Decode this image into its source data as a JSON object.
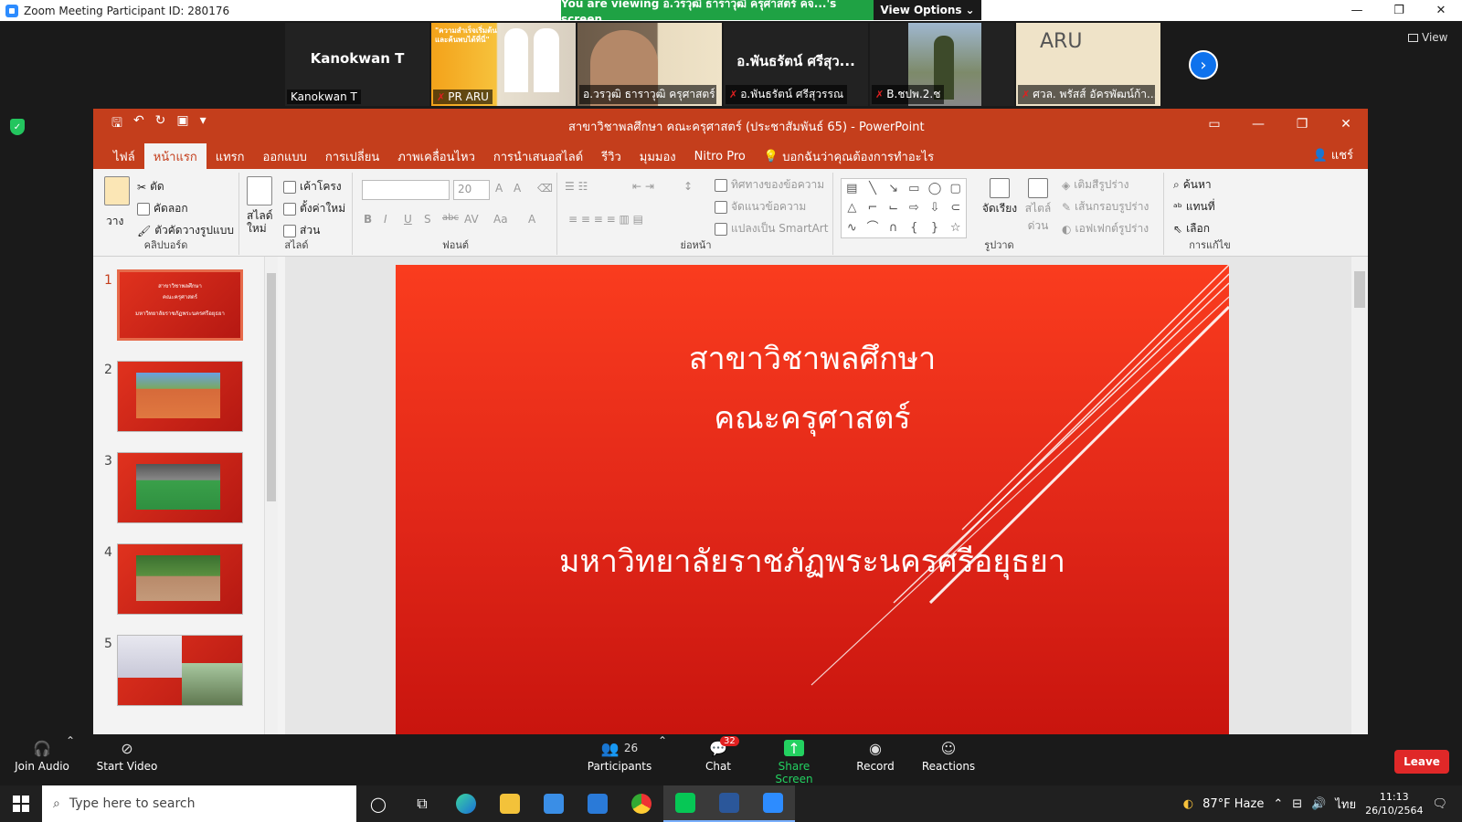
{
  "zoom": {
    "window_title": "Zoom Meeting Participant ID: 280176",
    "viewing_banner": "You are viewing อ.วรวุฒิ ธาราวุฒิ ครุศาสตร์ คจ...'s screen",
    "view_options": "View Options",
    "view_button": "View",
    "participants": [
      {
        "name": "Kanokwan T",
        "label": "Kanokwan T",
        "muted": false,
        "active": false
      },
      {
        "name": "PR ARU",
        "label": "PR ARU",
        "muted": true,
        "active": false
      },
      {
        "name": "อ.วรวุฒิ ธาราวุฒิ ครุศาสตร์",
        "label": "อ.วรวุฒิ ธาราวุฒิ ครุศาสตร์ ...",
        "muted": false,
        "active": true
      },
      {
        "name": "อ.พันธรัตน์ ศรีสุว...",
        "label": "อ.พันธรัตน์ ศรีสุวรรณ",
        "muted": true,
        "active": false
      },
      {
        "name": "B.ชปพ.2.ช",
        "label": "B.ชปพ.2.ช",
        "muted": true,
        "active": false
      },
      {
        "name": "ศวล. พรัสส์ อัครพัฒน์ก้า...",
        "label": "ศวล. พรัสส์ อัครพัฒน์ก้า...",
        "muted": true,
        "active": false
      }
    ],
    "tile_texts": {
      "pr_aru_headline": "\"ความสำเร็จเริ่มต้นและค้นพบได้ที่นี่\"",
      "aru_logo": "ARU"
    },
    "toolbar": {
      "join_audio": "Join Audio",
      "start_video": "Start Video",
      "participants_label": "Participants",
      "participants_count": "26",
      "chat": "Chat",
      "chat_badge": "32",
      "share_screen": "Share Screen",
      "record": "Record",
      "reactions": "Reactions",
      "leave": "Leave"
    }
  },
  "powerpoint": {
    "title": "สาขาวิชาพลศึกษา คณะครุศาสตร์ (ประชาสัมพันธ์ 65)  -  PowerPoint",
    "tabs": [
      "ไฟล์",
      "หน้าแรก",
      "แทรก",
      "ออกแบบ",
      "การเปลี่ยน",
      "ภาพเคลื่อนไหว",
      "การนำเสนอสไลด์",
      "รีวิว",
      "มุมมอง",
      "Nitro Pro"
    ],
    "active_tab": "หน้าแรก",
    "tell_me": "บอกฉันว่าคุณต้องการทำอะไร",
    "share": "แชร์",
    "ribbon": {
      "clipboard": {
        "paste": "วาง",
        "cut": "ตัด",
        "copy": "คัดลอก",
        "format_painter": "ตัวคัดวางรูปแบบ",
        "group": "คลิปบอร์ด"
      },
      "slides": {
        "new_slide": "สไลด์ใหม่",
        "layout": "เค้าโครง",
        "reset": "ตั้งค่าใหม่",
        "section": "ส่วน",
        "group": "สไลด์"
      },
      "font": {
        "font_size": "20",
        "group": "ฟอนต์",
        "bold": "B",
        "italic": "I",
        "underline": "U",
        "shadow": "S",
        "strike": "abc",
        "spacing": "AV",
        "case": "Aa",
        "color": "A",
        "grow": "A",
        "shrink": "A"
      },
      "paragraph": {
        "text_direction": "ทิศทางของข้อความ",
        "align_text": "จัดแนวข้อความ",
        "smartart": "แปลงเป็น SmartArt",
        "group": "ย่อหน้า"
      },
      "drawing": {
        "arrange": "จัดเรียง",
        "quick_styles": "สไตล์ ด่วน",
        "shape_fill": "เติมสีรูปร่าง",
        "shape_outline": "เส้นกรอบรูปร่าง",
        "shape_effects": "เอฟเฟกต์รูปร่าง",
        "group": "รูปวาด"
      },
      "editing": {
        "find": "ค้นหา",
        "replace": "แทนที่",
        "select": "เลือก",
        "group": "การแก้ไข"
      }
    },
    "thumbnails": [
      {
        "num": "1",
        "selected": true
      },
      {
        "num": "2",
        "selected": false
      },
      {
        "num": "3",
        "selected": false
      },
      {
        "num": "4",
        "selected": false
      },
      {
        "num": "5",
        "selected": false
      }
    ],
    "thumb1_lines": [
      "สาขาวิชาพลศึกษา",
      "คณะครุศาสตร์",
      "มหาวิทยาลัยราชภัฏพระนครศรีอยุธยา"
    ],
    "slide": {
      "line1": "สาขาวิชาพลศึกษา",
      "line2": "คณะครุศาสตร์",
      "line3": "มหาวิทยาลัยราชภัฏพระนครศรีอยุธยา",
      "bg_color": "#e52a1b"
    }
  },
  "taskbar": {
    "search_placeholder": "Type here to search",
    "weather": "87°F  Haze",
    "lang": "ไทย",
    "time": "11:13",
    "date": "26/10/2564"
  },
  "colors": {
    "ppt_accent": "#c43e1c",
    "zoom_green": "#1fa244",
    "leave_red": "#e02828"
  }
}
